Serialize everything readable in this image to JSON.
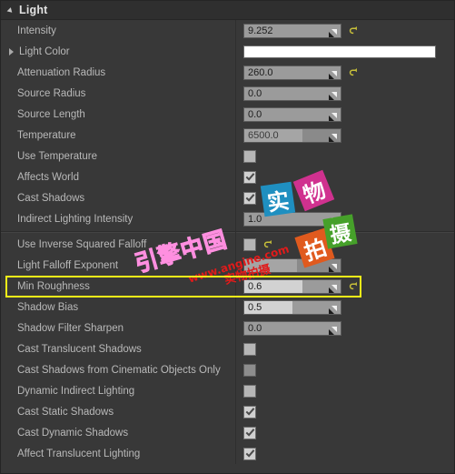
{
  "panel": {
    "category": {
      "title": "Light",
      "expand_icon": "triangle-down-icon"
    },
    "rows": [
      {
        "label": "Intensity",
        "type": "number",
        "value": "9.252",
        "fill_pct": 0,
        "reset": true,
        "disabled": false
      },
      {
        "label": "Light Color",
        "type": "color",
        "value": "#FFFFFF",
        "expandable": true
      },
      {
        "label": "Attenuation Radius",
        "type": "number",
        "value": "260.0",
        "fill_pct": 0,
        "reset": true,
        "disabled": false
      },
      {
        "label": "Source Radius",
        "type": "number",
        "value": "0.0",
        "fill_pct": 0,
        "reset": false,
        "disabled": false
      },
      {
        "label": "Source Length",
        "type": "number",
        "value": "0.0",
        "fill_pct": 0,
        "reset": false,
        "disabled": false
      },
      {
        "label": "Temperature",
        "type": "number",
        "value": "6500.0",
        "fill_pct": 60,
        "reset": false,
        "disabled": true
      },
      {
        "label": "Use Temperature",
        "type": "checkbox",
        "checked": false,
        "disabled": false
      },
      {
        "label": "Affects World",
        "type": "checkbox",
        "checked": true,
        "disabled": false
      },
      {
        "label": "Cast Shadows",
        "type": "checkbox",
        "checked": true,
        "disabled": false
      },
      {
        "label": "Indirect Lighting Intensity",
        "type": "number",
        "value": "1.0",
        "fill_pct": 0,
        "reset": false,
        "disabled": false
      },
      {
        "type": "separator"
      },
      {
        "label": "Use Inverse Squared Falloff",
        "type": "checkbox",
        "checked": false,
        "disabled": false,
        "reset": true
      },
      {
        "label": "Light Falloff Exponent",
        "type": "number",
        "value": "",
        "fill_pct": 55,
        "reset": false,
        "disabled": true
      },
      {
        "label": "Min Roughness",
        "type": "number",
        "value": "0.6",
        "fill_pct": 60,
        "reset": true,
        "disabled": false,
        "highlighted": true
      },
      {
        "label": "Shadow Bias",
        "type": "number",
        "value": "0.5",
        "fill_pct": 50,
        "reset": false,
        "disabled": false
      },
      {
        "label": "Shadow Filter Sharpen",
        "type": "number",
        "value": "0.0",
        "fill_pct": 0,
        "reset": false,
        "disabled": false
      },
      {
        "label": "Cast Translucent Shadows",
        "type": "checkbox",
        "checked": false,
        "disabled": false
      },
      {
        "label": "Cast Shadows from Cinematic Objects Only",
        "type": "checkbox",
        "checked": false,
        "disabled": true
      },
      {
        "label": "Dynamic Indirect Lighting",
        "type": "checkbox",
        "checked": false,
        "disabled": false
      },
      {
        "label": "Cast Static Shadows",
        "type": "checkbox",
        "checked": true,
        "disabled": false
      },
      {
        "label": "Cast Dynamic Shadows",
        "type": "checkbox",
        "checked": true,
        "disabled": false
      },
      {
        "label": "Affect Translucent Lighting",
        "type": "checkbox",
        "checked": true,
        "disabled": false
      }
    ]
  },
  "highlight": {
    "target_label": "Min Roughness",
    "color": "#F5F318"
  },
  "watermark": {
    "brand_cn": "引擎中国",
    "url": "www.angine.com",
    "tagline": "实物拍摄",
    "tiles": [
      {
        "char": "实",
        "color": "#1f8fc0"
      },
      {
        "char": "物",
        "color": "#d0318f"
      },
      {
        "char": "拍",
        "color": "#e05a1e"
      },
      {
        "char": "摄",
        "color": "#46a02a"
      }
    ]
  },
  "colors": {
    "panel_bg": "#383838",
    "header_bg": "#2F2F2F",
    "label_text": "#B9B9B9",
    "field_bg": "#9B9B9B",
    "field_fill": "#D2D2D2",
    "reset_icon": "#C8C03A"
  }
}
